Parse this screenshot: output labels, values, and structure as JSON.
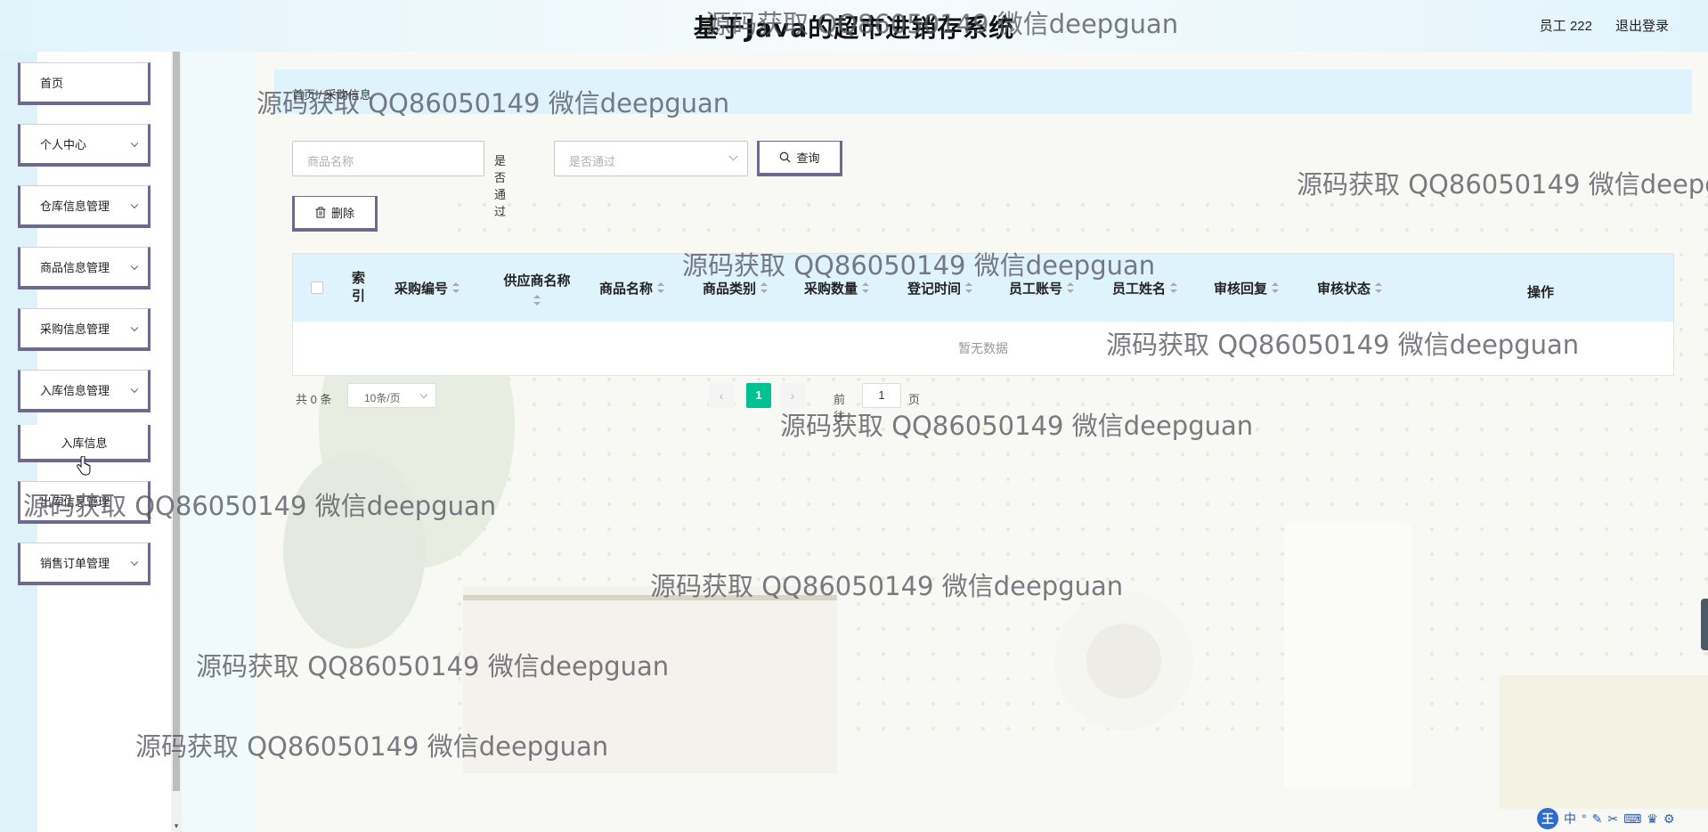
{
  "header": {
    "title": "基于Java的超市进销存系统",
    "user": "员工 222",
    "logout": "退出登录"
  },
  "sidebar": {
    "items": [
      {
        "label": "首页"
      },
      {
        "label": "个人中心"
      },
      {
        "label": "仓库信息管理"
      },
      {
        "label": "商品信息管理"
      },
      {
        "label": "采购信息管理"
      },
      {
        "label": "入库信息管理"
      },
      {
        "label": "入库信息"
      },
      {
        "label": "出库信息管理"
      },
      {
        "label": "销售订单管理"
      }
    ]
  },
  "breadcrumb": "首页 / 采购信息",
  "filters": {
    "product_placeholder": "商品名称",
    "approved_label": "是否通过",
    "approved_placeholder": "是否通过",
    "query_button": "查询"
  },
  "toolbar": {
    "delete_button": "删除"
  },
  "table": {
    "columns": [
      "索引",
      "采购编号",
      "供应商名称",
      "商品名称",
      "商品类别",
      "采购数量",
      "登记时间",
      "员工账号",
      "员工姓名",
      "审核回复",
      "审核状态",
      "操作"
    ],
    "empty_text": "暂无数据"
  },
  "pagination": {
    "total": "共 0 条",
    "page_size": "10条/页",
    "current_page": "1",
    "goto_label": "前往",
    "goto_value": "1",
    "page_unit": "页"
  },
  "watermark": "源码获取 QQ86050149 微信deepguan",
  "ime": {
    "logo": "王",
    "mode": "中"
  }
}
